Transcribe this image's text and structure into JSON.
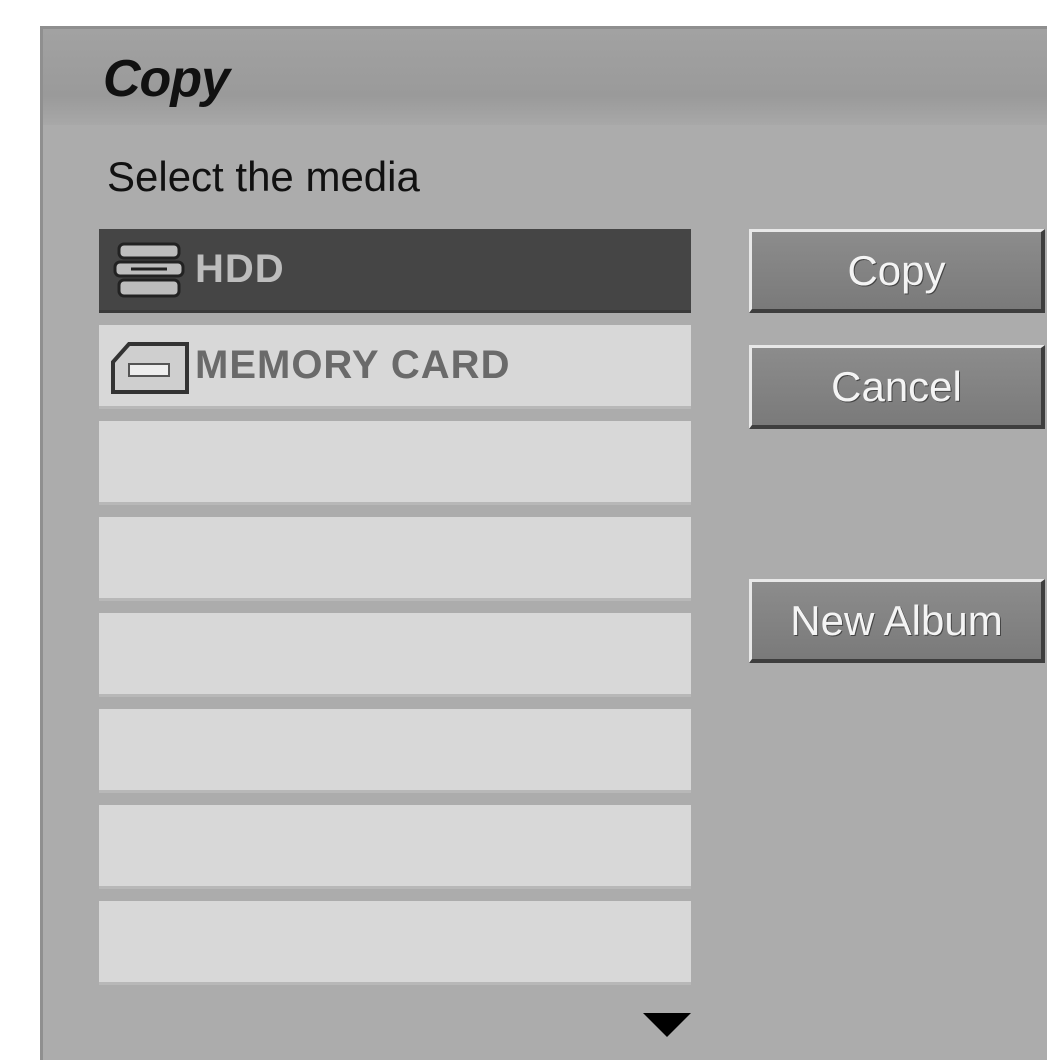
{
  "dialog": {
    "title": "Copy",
    "subtitle": "Select the media"
  },
  "media_list": {
    "items": [
      {
        "label": "HDD",
        "icon": "hdd-icon",
        "selected": true
      },
      {
        "label": "MEMORY CARD",
        "icon": "memory-card-icon",
        "selected": false
      },
      {
        "label": "",
        "selected": false
      },
      {
        "label": "",
        "selected": false
      },
      {
        "label": "",
        "selected": false
      },
      {
        "label": "",
        "selected": false
      },
      {
        "label": "",
        "selected": false
      },
      {
        "label": "",
        "selected": false
      }
    ],
    "scroll_icon": "triangle-down-icon"
  },
  "buttons": {
    "copy": "Copy",
    "cancel": "Cancel",
    "new_album": "New Album"
  }
}
